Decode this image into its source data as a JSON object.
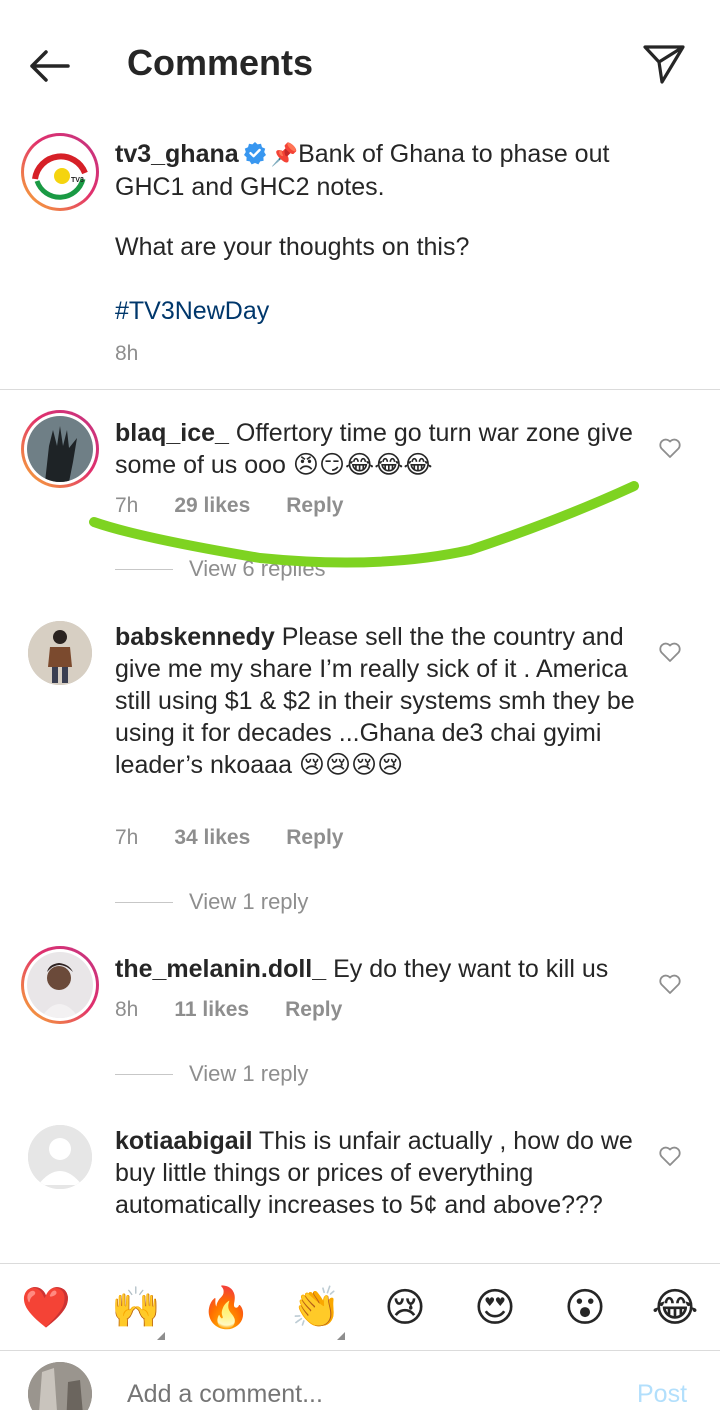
{
  "header": {
    "title": "Comments",
    "back_icon": "arrow-left-icon",
    "send_icon": "paper-plane-icon"
  },
  "caption": {
    "username": "tv3_ghana",
    "pin_emoji": "📌",
    "text": "Bank of Ghana to phase out GHC1 and GHC2 notes.",
    "question": "What are your thoughts on this?",
    "hashtag": "#TV3NewDay",
    "time": "8h",
    "avatar_logo_text": "TV3"
  },
  "comments": [
    {
      "username": "blaq_ice_",
      "text": "Offertory time go turn war zone give some of us ooo 😠😏😂😂😂",
      "time": "7h",
      "likes": "29 likes",
      "reply": "Reply",
      "view_replies": "View 6 replies"
    },
    {
      "username": "babskennedy",
      "text": "Please sell the the country and give me my share I’m really sick of it . America still using $1 & $2 in their systems smh they be using it for decades ...Ghana de3 chai gyimi  leader’s nkoaaa 😢😢😢😢",
      "time": "7h",
      "likes": "34 likes",
      "reply": "Reply",
      "view_replies": "View 1 reply"
    },
    {
      "username": "the_melanin.doll_",
      "text": "Ey do they want to kill us",
      "time": "8h",
      "likes": "11 likes",
      "reply": "Reply",
      "view_replies": "View 1 reply"
    },
    {
      "username": "kotiaabigail",
      "text": "This is unfair actually , how do we buy little things or prices of everything automatically increases to 5¢ and above???"
    }
  ],
  "emoji_bar": [
    "❤️",
    "🙌",
    "🔥",
    "👏",
    "😢",
    "😍",
    "😮",
    "😂"
  ],
  "composer": {
    "placeholder": "Add a comment...",
    "post_label": "Post"
  },
  "colors": {
    "text": "#262626",
    "muted": "#8e8e8e",
    "link": "#00376b",
    "verified": "#3897f0",
    "post_disabled": "#b2dffc",
    "highlight_stroke": "#7ed321"
  }
}
